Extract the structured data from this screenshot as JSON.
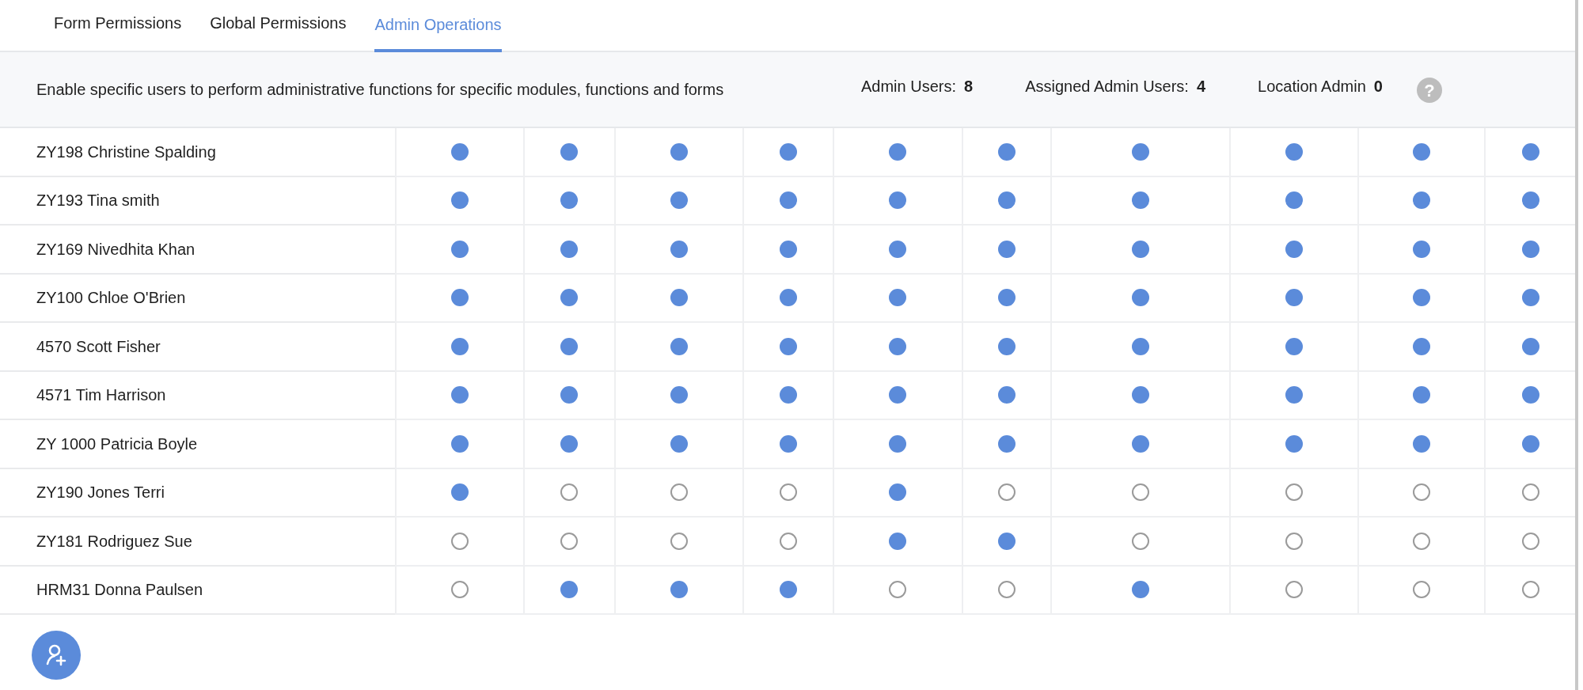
{
  "tabs": [
    {
      "label": "Form Permissions",
      "selected": false
    },
    {
      "label": "Global Permissions",
      "selected": false
    },
    {
      "label": "Admin Operations",
      "selected": true
    }
  ],
  "description": "Enable specific users to perform administrative functions for specific modules, functions and forms",
  "stats": [
    {
      "label": "Admin Users:",
      "value": "8"
    },
    {
      "label": "Assigned Admin Users:",
      "value": "4"
    },
    {
      "label": "Location Admin",
      "value": "0"
    }
  ],
  "help": {
    "symbol": "?"
  },
  "rows": [
    {
      "name": "ZY198 Christine Spalding",
      "permissions": [
        true,
        true,
        true,
        true,
        true,
        true,
        true,
        true,
        true,
        true
      ]
    },
    {
      "name": "ZY193 Tina smith",
      "permissions": [
        true,
        true,
        true,
        true,
        true,
        true,
        true,
        true,
        true,
        true
      ]
    },
    {
      "name": "ZY169 Nivedhita Khan",
      "permissions": [
        true,
        true,
        true,
        true,
        true,
        true,
        true,
        true,
        true,
        true
      ]
    },
    {
      "name": "ZY100 Chloe O'Brien",
      "permissions": [
        true,
        true,
        true,
        true,
        true,
        true,
        true,
        true,
        true,
        true
      ]
    },
    {
      "name": "4570 Scott Fisher",
      "permissions": [
        true,
        true,
        true,
        true,
        true,
        true,
        true,
        true,
        true,
        true
      ]
    },
    {
      "name": "4571 Tim Harrison",
      "permissions": [
        true,
        true,
        true,
        true,
        true,
        true,
        true,
        true,
        true,
        true
      ]
    },
    {
      "name": "ZY 1000 Patricia Boyle",
      "permissions": [
        true,
        true,
        true,
        true,
        true,
        true,
        true,
        true,
        true,
        true
      ]
    },
    {
      "name": "ZY190 Jones Terri",
      "permissions": [
        true,
        false,
        false,
        false,
        true,
        false,
        false,
        false,
        false,
        false
      ]
    },
    {
      "name": "ZY181 Rodriguez Sue",
      "permissions": [
        false,
        false,
        false,
        false,
        true,
        true,
        false,
        false,
        false,
        false
      ]
    },
    {
      "name": "HRM31 Donna Paulsen",
      "permissions": [
        false,
        true,
        true,
        true,
        false,
        false,
        true,
        false,
        false,
        false
      ]
    }
  ]
}
